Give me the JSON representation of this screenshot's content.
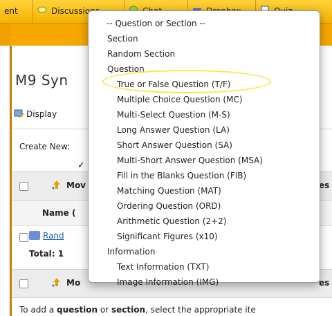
{
  "tabs": [
    {
      "label": "ent",
      "icon": "none"
    },
    {
      "label": "Discussions",
      "icon": "discussion-icon"
    },
    {
      "label": "Chat",
      "icon": "chat-icon"
    },
    {
      "label": "Dropbox",
      "icon": "dropbox-icon"
    },
    {
      "label": "Quiz",
      "icon": "quiz-icon"
    }
  ],
  "page": {
    "title": "M9 Syn",
    "display_label": "Display",
    "create_new_label": "Create New:",
    "move_label_1": "Mov",
    "move_label_2": "Mo",
    "edit_values_label": "Edit Values",
    "es_label": "es",
    "name_header": "Name (",
    "row_link": "Rand",
    "total_label": "Total: 1",
    "hint_prefix": "To add a ",
    "hint_question": "question",
    "hint_or": " or ",
    "hint_section": "section",
    "hint_suffix": ", select the appropriate ite"
  },
  "menu": {
    "placeholder": "-- Question or Section --",
    "items": [
      {
        "label": "Section",
        "level": "h"
      },
      {
        "label": "Random Section",
        "level": "h"
      },
      {
        "label": "Question",
        "level": "h"
      },
      {
        "label": "True or False Question (T/F)",
        "level": "s"
      },
      {
        "label": "Multiple Choice Question (MC)",
        "level": "s"
      },
      {
        "label": "Multi-Select Question (M-S)",
        "level": "s"
      },
      {
        "label": "Long Answer Question (LA)",
        "level": "s"
      },
      {
        "label": "Short Answer Question (SA)",
        "level": "s",
        "checked": true
      },
      {
        "label": "Multi-Short Answer Question (MSA)",
        "level": "s"
      },
      {
        "label": "Fill in the Blanks Question (FIB)",
        "level": "s"
      },
      {
        "label": "Matching Question (MAT)",
        "level": "s"
      },
      {
        "label": "Ordering Question (ORD)",
        "level": "s"
      },
      {
        "label": "Arithmetic Question (2+2)",
        "level": "s"
      },
      {
        "label": "Significant Figures (x10)",
        "level": "s"
      },
      {
        "label": "Information",
        "level": "h"
      },
      {
        "label": "Text Information (TXT)",
        "level": "s"
      },
      {
        "label": "Image Information (IMG)",
        "level": "s"
      }
    ],
    "check_glyph": "✓"
  },
  "colors": {
    "tab_bar": "#f4b300",
    "accent_orange": "#f0a000",
    "link": "#1a5fb4",
    "highlight_ring": "#f2ea4a"
  }
}
